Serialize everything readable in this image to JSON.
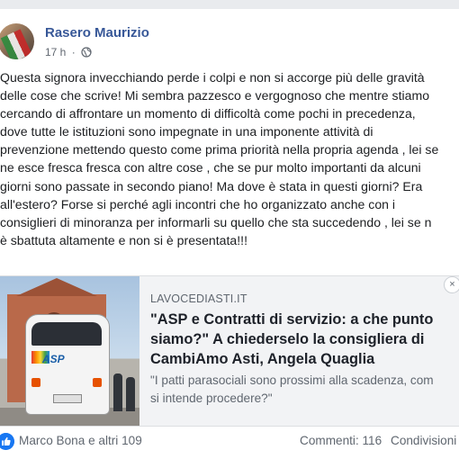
{
  "post": {
    "author": "Rasero Maurizio",
    "time": "17 h",
    "separator": "·",
    "privacy_icon": "globe-icon",
    "text_lines": [
      "Questa signora invecchiando perde i colpi e non si accorge più delle gravità",
      "delle cose che scrive! Mi sembra pazzesco e vergognoso che mentre stiamo",
      "cercando di affrontare un momento di difficoltà come pochi in precedenza,",
      "dove tutte le istituzioni sono impegnate in una imponente attività di",
      "prevenzione mettendo questo come prima priorità nella propria agenda , lei se",
      "ne esce fresca fresca con altre cose , che se pur molto importanti da alcuni",
      "giorni sono passate in secondo piano! Ma dove è stata in questi giorni? Era",
      "all'estero? Forse si perché agli incontri che ho organizzato anche con i",
      "consiglieri di minoranza per informarli su quello che sta succedendo , lei se n",
      "è sbattuta altamente e non si è presentata!!!"
    ]
  },
  "link_preview": {
    "domain": "LAVOCEDIASTI.IT",
    "title_lines": [
      "\"ASP e Contratti di servizio: a che punto",
      "siamo?\" A chiederselo la consigliera di",
      "CambiAmo Asti, Angela Quaglia"
    ],
    "description_lines": [
      "\"I patti parasociali sono prossimi alla scadenza, com",
      "si intende procedere?\""
    ],
    "image_logo_text": "ASP",
    "close_glyph": "×"
  },
  "footer": {
    "reactors": "Marco Bona e altri 109",
    "comments": "Commenti: 116",
    "shares": "Condivisioni"
  },
  "colors": {
    "author": "#385898",
    "like": "#1877f2",
    "muted": "#606770"
  }
}
